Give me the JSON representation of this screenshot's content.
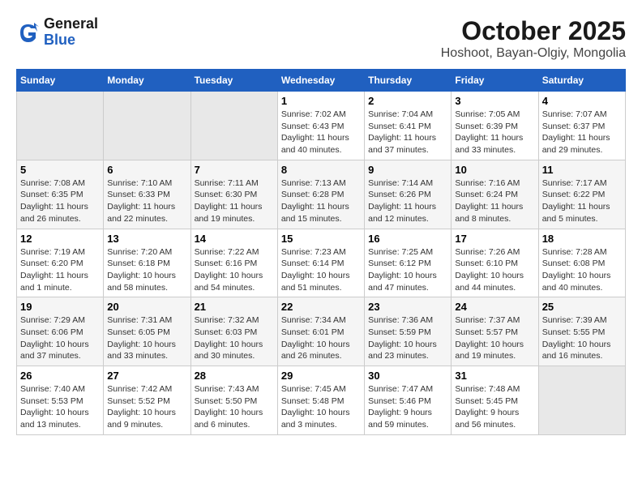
{
  "header": {
    "logo_general": "General",
    "logo_blue": "Blue",
    "title": "October 2025",
    "subtitle": "Hoshoot, Bayan-Olgiy, Mongolia"
  },
  "days_of_week": [
    "Sunday",
    "Monday",
    "Tuesday",
    "Wednesday",
    "Thursday",
    "Friday",
    "Saturday"
  ],
  "weeks": [
    [
      {
        "day": "",
        "sunrise": "",
        "sunset": "",
        "daylight": ""
      },
      {
        "day": "",
        "sunrise": "",
        "sunset": "",
        "daylight": ""
      },
      {
        "day": "",
        "sunrise": "",
        "sunset": "",
        "daylight": ""
      },
      {
        "day": "1",
        "sunrise": "Sunrise: 7:02 AM",
        "sunset": "Sunset: 6:43 PM",
        "daylight": "Daylight: 11 hours and 40 minutes."
      },
      {
        "day": "2",
        "sunrise": "Sunrise: 7:04 AM",
        "sunset": "Sunset: 6:41 PM",
        "daylight": "Daylight: 11 hours and 37 minutes."
      },
      {
        "day": "3",
        "sunrise": "Sunrise: 7:05 AM",
        "sunset": "Sunset: 6:39 PM",
        "daylight": "Daylight: 11 hours and 33 minutes."
      },
      {
        "day": "4",
        "sunrise": "Sunrise: 7:07 AM",
        "sunset": "Sunset: 6:37 PM",
        "daylight": "Daylight: 11 hours and 29 minutes."
      }
    ],
    [
      {
        "day": "5",
        "sunrise": "Sunrise: 7:08 AM",
        "sunset": "Sunset: 6:35 PM",
        "daylight": "Daylight: 11 hours and 26 minutes."
      },
      {
        "day": "6",
        "sunrise": "Sunrise: 7:10 AM",
        "sunset": "Sunset: 6:33 PM",
        "daylight": "Daylight: 11 hours and 22 minutes."
      },
      {
        "day": "7",
        "sunrise": "Sunrise: 7:11 AM",
        "sunset": "Sunset: 6:30 PM",
        "daylight": "Daylight: 11 hours and 19 minutes."
      },
      {
        "day": "8",
        "sunrise": "Sunrise: 7:13 AM",
        "sunset": "Sunset: 6:28 PM",
        "daylight": "Daylight: 11 hours and 15 minutes."
      },
      {
        "day": "9",
        "sunrise": "Sunrise: 7:14 AM",
        "sunset": "Sunset: 6:26 PM",
        "daylight": "Daylight: 11 hours and 12 minutes."
      },
      {
        "day": "10",
        "sunrise": "Sunrise: 7:16 AM",
        "sunset": "Sunset: 6:24 PM",
        "daylight": "Daylight: 11 hours and 8 minutes."
      },
      {
        "day": "11",
        "sunrise": "Sunrise: 7:17 AM",
        "sunset": "Sunset: 6:22 PM",
        "daylight": "Daylight: 11 hours and 5 minutes."
      }
    ],
    [
      {
        "day": "12",
        "sunrise": "Sunrise: 7:19 AM",
        "sunset": "Sunset: 6:20 PM",
        "daylight": "Daylight: 11 hours and 1 minute."
      },
      {
        "day": "13",
        "sunrise": "Sunrise: 7:20 AM",
        "sunset": "Sunset: 6:18 PM",
        "daylight": "Daylight: 10 hours and 58 minutes."
      },
      {
        "day": "14",
        "sunrise": "Sunrise: 7:22 AM",
        "sunset": "Sunset: 6:16 PM",
        "daylight": "Daylight: 10 hours and 54 minutes."
      },
      {
        "day": "15",
        "sunrise": "Sunrise: 7:23 AM",
        "sunset": "Sunset: 6:14 PM",
        "daylight": "Daylight: 10 hours and 51 minutes."
      },
      {
        "day": "16",
        "sunrise": "Sunrise: 7:25 AM",
        "sunset": "Sunset: 6:12 PM",
        "daylight": "Daylight: 10 hours and 47 minutes."
      },
      {
        "day": "17",
        "sunrise": "Sunrise: 7:26 AM",
        "sunset": "Sunset: 6:10 PM",
        "daylight": "Daylight: 10 hours and 44 minutes."
      },
      {
        "day": "18",
        "sunrise": "Sunrise: 7:28 AM",
        "sunset": "Sunset: 6:08 PM",
        "daylight": "Daylight: 10 hours and 40 minutes."
      }
    ],
    [
      {
        "day": "19",
        "sunrise": "Sunrise: 7:29 AM",
        "sunset": "Sunset: 6:06 PM",
        "daylight": "Daylight: 10 hours and 37 minutes."
      },
      {
        "day": "20",
        "sunrise": "Sunrise: 7:31 AM",
        "sunset": "Sunset: 6:05 PM",
        "daylight": "Daylight: 10 hours and 33 minutes."
      },
      {
        "day": "21",
        "sunrise": "Sunrise: 7:32 AM",
        "sunset": "Sunset: 6:03 PM",
        "daylight": "Daylight: 10 hours and 30 minutes."
      },
      {
        "day": "22",
        "sunrise": "Sunrise: 7:34 AM",
        "sunset": "Sunset: 6:01 PM",
        "daylight": "Daylight: 10 hours and 26 minutes."
      },
      {
        "day": "23",
        "sunrise": "Sunrise: 7:36 AM",
        "sunset": "Sunset: 5:59 PM",
        "daylight": "Daylight: 10 hours and 23 minutes."
      },
      {
        "day": "24",
        "sunrise": "Sunrise: 7:37 AM",
        "sunset": "Sunset: 5:57 PM",
        "daylight": "Daylight: 10 hours and 19 minutes."
      },
      {
        "day": "25",
        "sunrise": "Sunrise: 7:39 AM",
        "sunset": "Sunset: 5:55 PM",
        "daylight": "Daylight: 10 hours and 16 minutes."
      }
    ],
    [
      {
        "day": "26",
        "sunrise": "Sunrise: 7:40 AM",
        "sunset": "Sunset: 5:53 PM",
        "daylight": "Daylight: 10 hours and 13 minutes."
      },
      {
        "day": "27",
        "sunrise": "Sunrise: 7:42 AM",
        "sunset": "Sunset: 5:52 PM",
        "daylight": "Daylight: 10 hours and 9 minutes."
      },
      {
        "day": "28",
        "sunrise": "Sunrise: 7:43 AM",
        "sunset": "Sunset: 5:50 PM",
        "daylight": "Daylight: 10 hours and 6 minutes."
      },
      {
        "day": "29",
        "sunrise": "Sunrise: 7:45 AM",
        "sunset": "Sunset: 5:48 PM",
        "daylight": "Daylight: 10 hours and 3 minutes."
      },
      {
        "day": "30",
        "sunrise": "Sunrise: 7:47 AM",
        "sunset": "Sunset: 5:46 PM",
        "daylight": "Daylight: 9 hours and 59 minutes."
      },
      {
        "day": "31",
        "sunrise": "Sunrise: 7:48 AM",
        "sunset": "Sunset: 5:45 PM",
        "daylight": "Daylight: 9 hours and 56 minutes."
      },
      {
        "day": "",
        "sunrise": "",
        "sunset": "",
        "daylight": ""
      }
    ]
  ]
}
